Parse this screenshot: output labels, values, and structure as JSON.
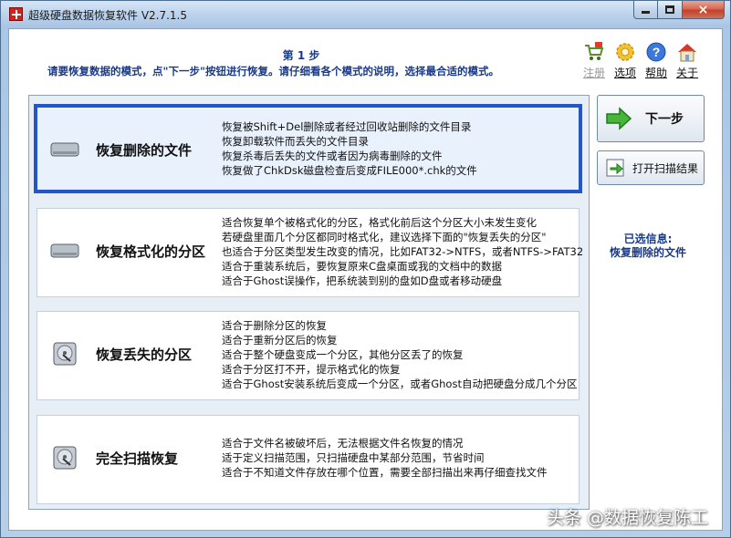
{
  "window": {
    "title": "超级硬盘数据恢复软件 V2.7.1.5",
    "min_label": "",
    "close_glyph": "×"
  },
  "header": {
    "step": "第 1 步",
    "instruction": "请要恢复数据的模式，点\"下一步\"按钮进行恢复。请仔细看各个模式的说明，选择最合适的模式。"
  },
  "toolbar": [
    {
      "label": "注册",
      "icon": "cart-icon",
      "enabled": false
    },
    {
      "label": "选项",
      "icon": "gear-icon",
      "enabled": true
    },
    {
      "label": "帮助",
      "icon": "help-icon",
      "enabled": true
    },
    {
      "label": "关于",
      "icon": "home-icon",
      "enabled": true
    }
  ],
  "options": [
    {
      "name": "恢复删除的文件",
      "selected": true,
      "lines": [
        "恢复被Shift+Del删除或者经过回收站删除的文件目录",
        "恢复卸载软件而丢失的文件目录",
        "恢复杀毒后丢失的文件或者因为病毒删除的文件",
        "恢复做了ChkDsk磁盘检查后变成FILE000*.chk的文件"
      ]
    },
    {
      "name": "恢复格式化的分区",
      "selected": false,
      "lines": [
        "适合恢复单个被格式化的分区，格式化前后这个分区大小未发生变化",
        "若硬盘里面几个分区都同时格式化，建议选择下面的\"恢复丢失的分区\"",
        "也适合于分区类型发生改变的情况，比如FAT32->NTFS，或者NTFS->FAT32",
        "适合于重装系统后，要恢复原来C盘桌面或我的文档中的数据",
        "适合于Ghost误操作，把系统装到别的盘如D盘或者移动硬盘"
      ]
    },
    {
      "name": "恢复丢失的分区",
      "selected": false,
      "lines": [
        "适合于删除分区的恢复",
        "适合于重新分区后的恢复",
        "适合于整个硬盘变成一个分区，其他分区丢了的恢复",
        "适合于分区打不开，提示格式化的恢复",
        "适合于Ghost安装系统后变成一个分区，或者Ghost自动把硬盘分成几个分区"
      ]
    },
    {
      "name": "完全扫描恢复",
      "selected": false,
      "lines": [
        "适合于文件名被破坏后，无法根据文件名恢复的情况",
        "适于定义扫描范围，只扫描硬盘中某部分范围，节省时间",
        "适合于不知道文件存放在哪个位置，需要全部扫描出来再仔细查找文件"
      ]
    }
  ],
  "buttons": {
    "next": "下一步",
    "open_scan": "打开扫描结果"
  },
  "selected_info": {
    "label": "已选信息:",
    "value": "恢复删除的文件"
  },
  "watermark": "头条 @数据恢复陈工",
  "colors": {
    "accent": "#2357c8",
    "info_text": "#1a3a86"
  }
}
